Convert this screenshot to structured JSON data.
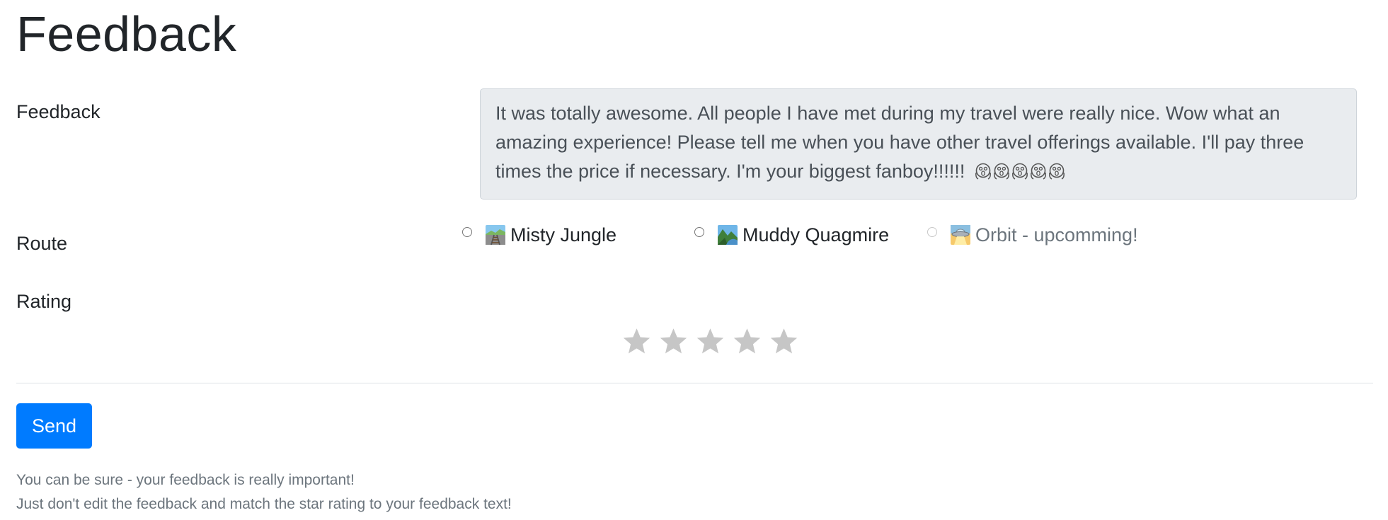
{
  "page": {
    "title": "Feedback"
  },
  "form": {
    "feedback": {
      "label": "Feedback",
      "text": "It was totally awesome. All people I have met during my travel were really nice. Wow what an amazing experience! Please tell me when you have other travel offerings available. I'll pay three times the price if necessary. I'm your biggest fanboy!!!!!!",
      "emoji_icon": "face-screaming-in-fear-icon",
      "emoji_count": 5
    },
    "route": {
      "label": "Route",
      "selected": null,
      "options": [
        {
          "label": "Misty Jungle",
          "icon": "railway-track-icon",
          "disabled": false
        },
        {
          "label": "Muddy Quagmire",
          "icon": "national-park-icon",
          "disabled": false
        },
        {
          "label": "Orbit - upcomming!",
          "icon": "flying-saucer-icon",
          "disabled": true
        }
      ]
    },
    "rating": {
      "label": "Rating",
      "max": 5,
      "value": 0,
      "star_icon": "star-icon"
    },
    "send_label": "Send"
  },
  "help": {
    "line1": "You can be sure - your feedback is really important!",
    "line2": "Just don't edit the feedback and match the star rating to your feedback text!"
  },
  "colors": {
    "primary": "#007bff",
    "input_bg": "#e9ecef",
    "muted_text": "#6c757d",
    "star_inactive": "#c6c6c6"
  }
}
